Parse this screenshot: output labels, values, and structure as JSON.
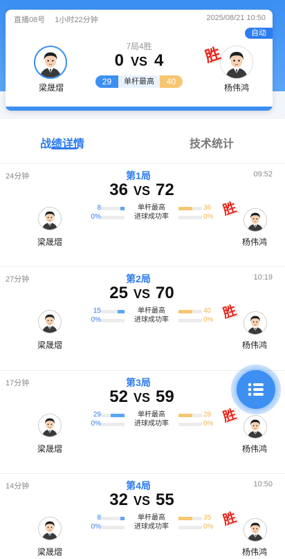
{
  "header": {
    "room": "直播08号",
    "duration": "1小时22分钟",
    "datetime": "2025/08/21 10:50",
    "auto_label": "自动",
    "format": "7局4胜",
    "left_player": "梁晟熠",
    "right_player": "杨伟鸿",
    "left_score": "0",
    "right_score": "4",
    "vs": "VS",
    "left_high_break": "29",
    "right_high_break": "40",
    "high_break_label": "单杆最高",
    "win_stamp": "胜"
  },
  "tabs": {
    "active": "战绩详情",
    "inactive": "技术统计"
  },
  "labels": {
    "high_break": "单杆最高",
    "pot_rate": "进球成功率",
    "win": "胜",
    "vs": "VS"
  },
  "rounds": [
    {
      "title": "第1局",
      "duration": "24分钟",
      "time": "09:52",
      "left_score": "36",
      "right_score": "72",
      "left_high": "8",
      "right_high": "36",
      "left_rate": "0%",
      "right_rate": "0%",
      "left_high_fill": 0.22,
      "right_high_fill": 1.0,
      "winner": "right",
      "left_name": "梁晟熠",
      "right_name": "杨伟鸿"
    },
    {
      "title": "第2局",
      "duration": "27分钟",
      "time": "10:19",
      "left_score": "25",
      "right_score": "70",
      "left_high": "15",
      "right_high": "40",
      "left_rate": "0%",
      "right_rate": "0%",
      "left_high_fill": 0.375,
      "right_high_fill": 1.0,
      "winner": "right",
      "left_name": "梁晟熠",
      "right_name": "杨伟鸿"
    },
    {
      "title": "第3局",
      "duration": "17分钟",
      "time": "",
      "left_score": "52",
      "right_score": "59",
      "left_high": "29",
      "right_high": "28",
      "left_rate": "0%",
      "right_rate": "0%",
      "left_high_fill": 1.0,
      "right_high_fill": 0.97,
      "winner": "right",
      "left_name": "梁晟熠",
      "right_name": "杨伟鸿"
    },
    {
      "title": "第4局",
      "duration": "14分钟",
      "time": "10:50",
      "left_score": "32",
      "right_score": "55",
      "left_high": "8",
      "right_high": "35",
      "left_rate": "0%",
      "right_rate": "0%",
      "left_high_fill": 0.23,
      "right_high_fill": 1.0,
      "winner": "right",
      "left_name": "梁晟熠",
      "right_name": "杨伟鸿"
    }
  ],
  "fab": {
    "icon": "list-icon"
  },
  "colors": {
    "primary": "#2d7cf0",
    "accent": "#f7c670",
    "win": "#e8261c"
  }
}
